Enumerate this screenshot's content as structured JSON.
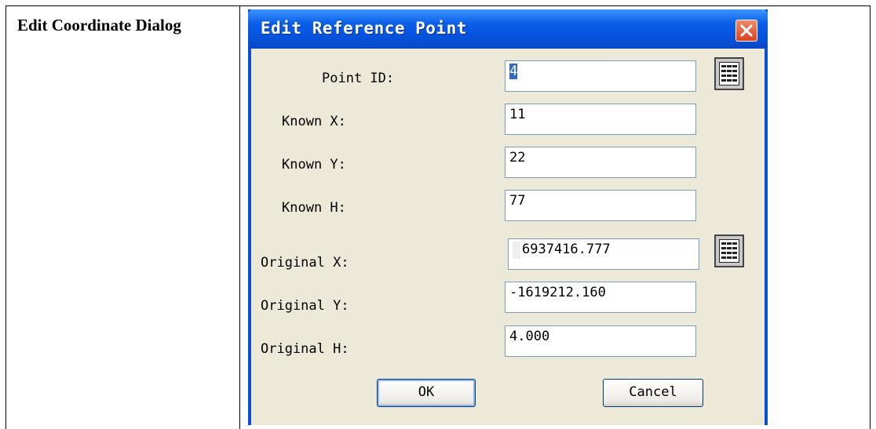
{
  "document": {
    "caption": "Edit Coordinate Dialog"
  },
  "dialog": {
    "title": "Edit Reference Point",
    "fields": [
      {
        "label": "Point ID:",
        "value": "4"
      },
      {
        "label": "Known X:",
        "value": "11"
      },
      {
        "label": "Known Y:",
        "value": "22"
      },
      {
        "label": "Known H:",
        "value": "77"
      },
      {
        "label": "Original X:",
        "value": "6937416.777"
      },
      {
        "label": "Original Y:",
        "value": "-1619212.160"
      },
      {
        "label": "Original H:",
        "value": "4.000"
      }
    ],
    "buttons": {
      "ok": "OK",
      "cancel": "Cancel"
    }
  },
  "icons": {
    "close": "close-icon",
    "point_list": "list-icon",
    "coordinate_list": "list-icon"
  },
  "colors": {
    "title_bar": "#0553E0",
    "dialog_background": "#ECE9D8",
    "close_button": "#D9431F",
    "selection": "#316AC5"
  }
}
